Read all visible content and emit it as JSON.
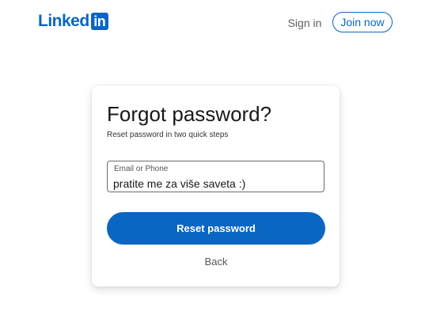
{
  "header": {
    "logo_text": "Linked",
    "logo_box_text": "in",
    "signin_label": "Sign in",
    "join_label": "Join now"
  },
  "card": {
    "title": "Forgot password?",
    "subtitle": "Reset password in two quick steps",
    "field": {
      "label": "Email or Phone",
      "value": "pratite me za više saveta :)"
    },
    "reset_label": "Reset password",
    "back_label": "Back"
  },
  "colors": {
    "brand": "#0a66c2",
    "text_dark": "#191919",
    "text_muted": "#5e5e5e"
  }
}
